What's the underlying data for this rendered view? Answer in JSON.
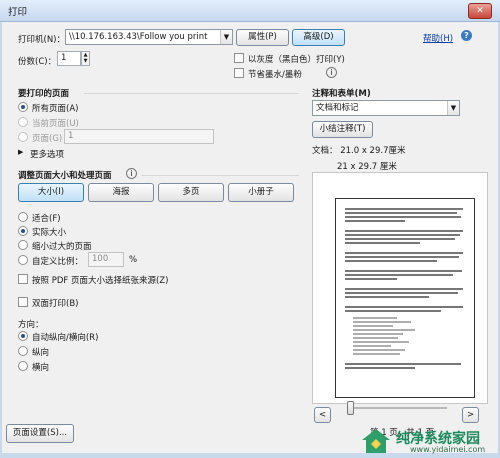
{
  "window": {
    "title": "打印",
    "close_glyph": "✕"
  },
  "printer": {
    "label": "打印机(N)：",
    "selected": "\\\\10.176.163.43\\Follow you print",
    "properties_btn": "属性(P)",
    "advanced_btn": "高级(D)",
    "help_link": "帮助(H)"
  },
  "copies": {
    "label": "份数(C)：",
    "value": "1",
    "grayscale": "以灰度（黑白色）打印(Y)",
    "save_ink": "节省墨水/墨粉"
  },
  "pages_section": {
    "title": "要打印的页面",
    "all": "所有页面(A)",
    "current": "当前页面(U)",
    "pages": "页面(G)",
    "pages_value": "1",
    "more": "更多选项"
  },
  "sizing_section": {
    "title": "调整页面大小和处理页面",
    "size_btn": "大小(I)",
    "poster_btn": "海报",
    "multiple_btn": "多页",
    "booklet_btn": "小册子",
    "fit": "适合(F)",
    "actual": "实际大小",
    "shrink": "缩小过大的页面",
    "custom": "自定义比例：",
    "custom_value": "100",
    "custom_unit": "%",
    "paper_source": "按照 PDF 页面大小选择纸张来源(Z)"
  },
  "duplex": "双面打印(B)",
  "orientation": {
    "title": "方向：",
    "auto": "自动纵向/横向(R)",
    "portrait": "纵向",
    "landscape": "横向"
  },
  "page_setup_btn": "页面设置(S)...",
  "comments": {
    "title": "注释和表单(M)",
    "selected": "文档和标记",
    "summarize_btn": "小结注释(T)"
  },
  "preview": {
    "doc_size": "文档：  21.0 x 29.7厘米",
    "paper_size": "21 x 29.7 厘米",
    "page_info": "第 1 页，共 1 页",
    "prev": "<",
    "next": ">"
  },
  "watermark": {
    "brand": "纯净系统家园",
    "url": "www.yidaimei.com"
  }
}
